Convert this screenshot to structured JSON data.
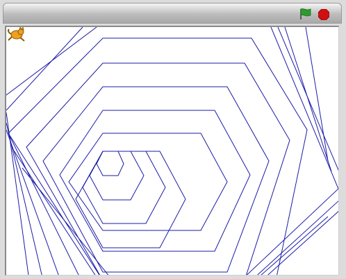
{
  "toolbar": {
    "green_flag_icon": "green-flag-icon",
    "stop_icon": "stop-icon"
  },
  "colors": {
    "pen": "#1a1aa8",
    "flag": "#2e9b2e",
    "stop": "#d01010",
    "sprite": "#f0a020"
  },
  "stage": {
    "sprite_icon": "cat-sprite-icon"
  }
}
